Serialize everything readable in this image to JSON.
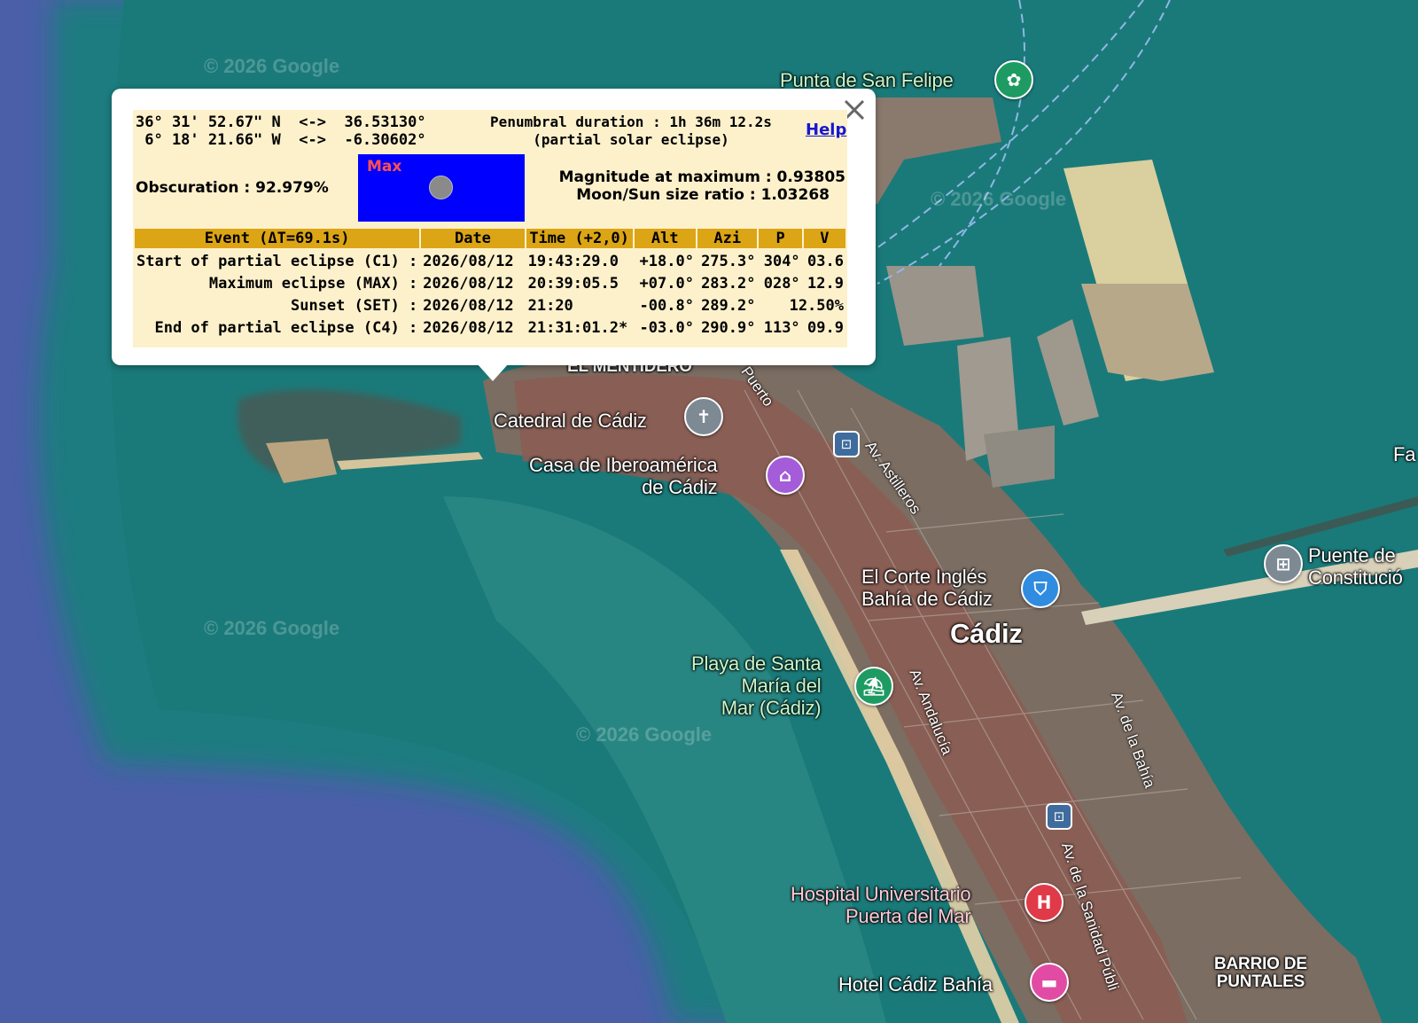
{
  "map": {
    "watermark": "© 2026 Google",
    "places": {
      "punta_san_felipe": "Punta de San Felipe",
      "el_mentidero": "EL MENTIDERO",
      "catedral": "Catedral de Cádiz",
      "casa_iberoamerica": "Casa de Iberoamérica\nde Cádiz",
      "corte_ingles": "El Corte Inglés\nBahía de Cádiz",
      "cadiz": "Cádiz",
      "playa": "Playa de Santa\nMaría del\nMar (Cádiz)",
      "hospital": "Hospital Universitario\nPuerta del Mar",
      "hotel": "Hotel Cádiz Bahía",
      "barrio_puntales": "BARRIO DE\nPUNTALES",
      "puente": "Puente de\nConstitució",
      "fa": "Fa"
    },
    "roads": {
      "puerto": "Puerto",
      "astilleros": "Av. Astilleros",
      "andalucia": "Av. Andalucía",
      "bahia": "Av. de la Bahía",
      "sanidad": "Av. de la Sanidad Públi"
    }
  },
  "popup": {
    "lat_dms": "36° 31' 52.67\" N",
    "lat_arrow": "<->",
    "lat_dec": "36.53130°",
    "lon_dms": " 6° 18' 21.66\" W",
    "lon_arrow": "<->",
    "lon_dec": "-6.30602°",
    "penumbral": "Penumbral duration : 1h 36m 12.2s",
    "eclipse_type": "(partial solar eclipse)",
    "help": "Help",
    "obscuration": "Obscuration : 92.979%",
    "max_label": "Max",
    "magnitude": "Magnitude at maximum : 0.93805",
    "size_ratio": "Moon/Sun size ratio : 1.03268",
    "columns": [
      "Event (ΔT=69.1s)",
      "Date",
      "Time (+2,0)",
      "Alt",
      "Azi",
      "P",
      "V"
    ],
    "rows": [
      {
        "event": "Start of partial eclipse (C1) :",
        "date": "2026/08/12",
        "time": "19:43:29.0",
        "alt": "+18.0°",
        "azi": "275.3°",
        "p": "304°",
        "v": "03.6"
      },
      {
        "event": "Maximum eclipse (MAX) :",
        "date": "2026/08/12",
        "time": "20:39:05.5",
        "alt": "+07.0°",
        "azi": "283.2°",
        "p": "028°",
        "v": "12.9"
      },
      {
        "event": "Sunset (SET) :",
        "date": "2026/08/12",
        "time": "21:20",
        "alt": "-00.8°",
        "azi": "289.2°",
        "p": "",
        "v": "12.50%"
      },
      {
        "event": "End of partial eclipse (C4) :",
        "date": "2026/08/12",
        "time": "21:31:01.2*",
        "alt": "-03.0°",
        "azi": "290.9°",
        "p": "113°",
        "v": "09.9"
      }
    ]
  }
}
